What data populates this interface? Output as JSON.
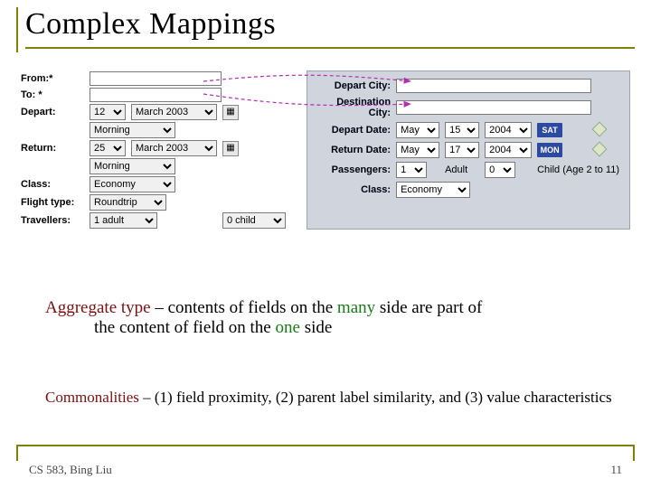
{
  "title": "Complex Mappings",
  "left_form": {
    "from": "From:*",
    "to": "To: *",
    "depart": "Depart:",
    "return": "Return:",
    "class": "Class:",
    "flight_type": "Flight type:",
    "travellers": "Travellers:",
    "depart_day": "12",
    "depart_month": "March 2003",
    "depart_time": "Morning",
    "return_day": "25",
    "return_month": "March 2003",
    "return_time": "Morning",
    "class_val": "Economy",
    "flight_type_val": "Roundtrip",
    "trav1": "1 adult",
    "trav2": "0 child"
  },
  "right_form": {
    "depart_city": "Depart City:",
    "dest_city1": "Destination",
    "dest_city2": "City:",
    "depart_date": "Depart Date:",
    "return_date": "Return Date:",
    "passengers": "Passengers:",
    "class": "Class:",
    "dd_month": "May",
    "dd_day": "15",
    "dd_year": "2004",
    "dd_dow": "SAT",
    "rd_month": "May",
    "rd_day": "17",
    "rd_year": "2004",
    "rd_dow": "MON",
    "p_adult_n": "1",
    "p_adult_l": "Adult",
    "p_child_n": "0",
    "p_child_l": "Child (Age 2 to 11)",
    "class_val": "Economy"
  },
  "aggregate": {
    "label": "Aggregate type",
    "sep": " – ",
    "text1": "contents of fields on the ",
    "many": "many",
    "text2": " side are part of the content of field on the ",
    "one": "one",
    "text3": " side"
  },
  "commonalities": {
    "label": "Commonalities",
    "rest": " – (1) field proximity, (2) parent label similarity, and (3) value characteristics"
  },
  "footer_left": "CS 583, Bing Liu",
  "footer_right": "11"
}
